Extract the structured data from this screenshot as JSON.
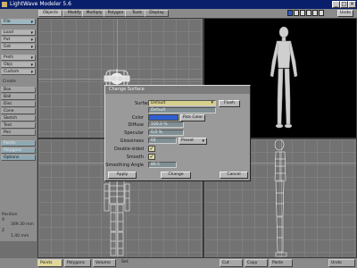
{
  "window": {
    "title": "LightWave Modeler 5.6"
  },
  "tabs": [
    {
      "label": "Objects",
      "active": true
    },
    {
      "label": "Modify",
      "active": false
    },
    {
      "label": "Multiply",
      "active": false
    },
    {
      "label": "Polygon",
      "active": false
    },
    {
      "label": "Tools",
      "active": false
    },
    {
      "label": "Display",
      "active": false
    }
  ],
  "topbar": {
    "undo_label": "Undo",
    "layer_colors": [
      "#2e57c7",
      "#d9d9d9",
      "#d9d9d9",
      "#d9d9d9",
      "#d9d9d9",
      "#d9d9d9"
    ]
  },
  "sidebar": {
    "file": "File",
    "load": "Load",
    "put": "Put",
    "get": "Get",
    "prefs": "Prefs",
    "objs": "Objs",
    "custom": "Custom",
    "create_header": "Create",
    "create_tools": [
      "Box",
      "Ball",
      "Disc",
      "Cone",
      "Sketch",
      "Text",
      "Pen"
    ],
    "groups": [
      "Points",
      "Polygons",
      "Options"
    ],
    "info": {
      "label": "Position",
      "x": "X",
      "y": "Y",
      "z": "Z",
      "value": "309.30 mm",
      "z_value": "1.40 mm"
    }
  },
  "dialog": {
    "title": "Change Surface",
    "surface_label": "Surface",
    "surface_value": "Default",
    "surface_name": "Default",
    "flush_label": "Flush",
    "color_label": "Color",
    "pick_color_label": "Pick Color",
    "diffuse_label": "Diffuse",
    "diffuse_value": "100.0 %",
    "specular_label": "Specular",
    "specular_value": "0.0 %",
    "glossiness_label": "Glossiness",
    "glossiness_value": "64",
    "preset_label": "Preset",
    "double_sided_label": "Double-sided",
    "smooth_label": "Smooth",
    "smoothing_angle_label": "Smoothing Angle",
    "smoothing_angle_value": "89.5",
    "apply_label": "Apply",
    "change_label": "Change",
    "cancel_label": "Cancel",
    "surface_color": "#2f5fd0"
  },
  "bottombar": {
    "points": "Points",
    "polygons": "Polygons",
    "volume": "Volume",
    "sel": "Sel:",
    "cut": "Cut",
    "copy": "Copy",
    "paste": "Paste",
    "undo": "Undo"
  }
}
